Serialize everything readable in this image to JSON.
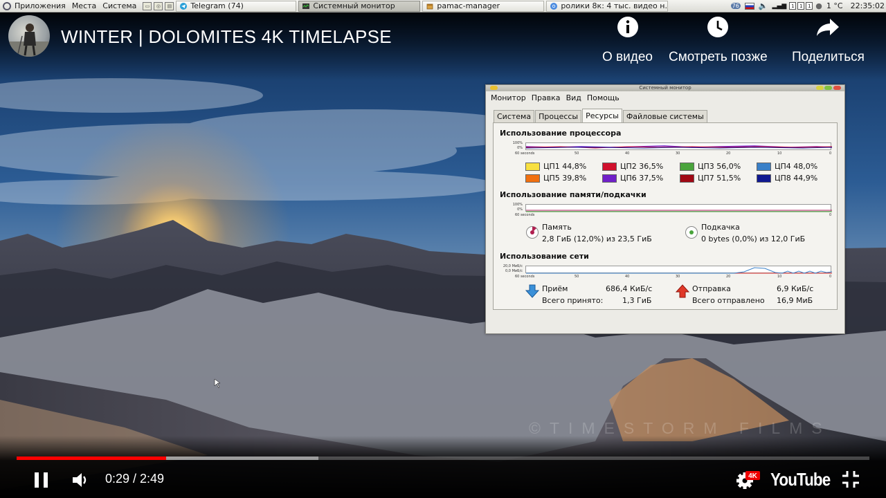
{
  "taskbar": {
    "menus": [
      "Приложения",
      "Места",
      "Система"
    ],
    "tasks": [
      {
        "label": "Telegram (74)",
        "active": false
      },
      {
        "label": "Системный монитор",
        "active": true
      },
      {
        "label": "pamac-manager",
        "active": false
      },
      {
        "label": "ролики 8к: 4 тыс. видео н...",
        "active": false
      }
    ],
    "tray": {
      "badge": "76",
      "kbd": [
        "1",
        "1",
        "1"
      ],
      "weather": "1 °C",
      "clock": "22:35:02"
    }
  },
  "video": {
    "title": "WINTER | DOLOMITES 4K TIMELAPSE",
    "actions": {
      "info": "О видео",
      "watch_later": "Смотреть позже",
      "share": "Поделиться"
    },
    "watermark": "©TIMESTORM FILMS",
    "time": "0:29 / 2:49",
    "quality_badge": "4K",
    "logo": "YouTube",
    "progress": {
      "played": 0.175,
      "buffered": 0.354
    }
  },
  "sysmon": {
    "title": "Системный монитор",
    "menu": [
      "Монитор",
      "Правка",
      "Вид",
      "Помощь"
    ],
    "tabs": [
      "Система",
      "Процессы",
      "Ресурсы",
      "Файловые системы"
    ],
    "active_tab": "Ресурсы",
    "axis_labels": {
      "x_left": "60 seconds",
      "ticks": [
        "50",
        "40",
        "30",
        "20",
        "10",
        "0"
      ]
    },
    "cpu": {
      "title": "Использование процессора",
      "y_top": "100%",
      "y_bottom": "0%",
      "cores": [
        {
          "label": "ЦП1 44,8%",
          "color": "#f8e040"
        },
        {
          "label": "ЦП2 36,5%",
          "color": "#d0102c"
        },
        {
          "label": "ЦП3 56,0%",
          "color": "#4aa43c"
        },
        {
          "label": "ЦП4 48,0%",
          "color": "#3a80c8"
        },
        {
          "label": "ЦП5 39,8%",
          "color": "#f07010"
        },
        {
          "label": "ЦП6 37,5%",
          "color": "#7020c8"
        },
        {
          "label": "ЦП7 51,5%",
          "color": "#a00814"
        },
        {
          "label": "ЦП8 44,9%",
          "color": "#101890"
        }
      ]
    },
    "memory": {
      "title": "Использование памяти/подкачки",
      "y_top": "100%",
      "y_bottom": "0%",
      "ram_label": "Память",
      "ram_value": "2,8 ГиБ (12,0%) из 23,5 ГиБ",
      "swap_label": "Подкачка",
      "swap_value": "0 bytes (0,0%) из 12,0 ГиБ"
    },
    "network": {
      "title": "Использование сети",
      "y_top": "20,0 МиБ/с",
      "y_bottom": "0,0 МиБ/с",
      "recv_label": "Приём",
      "recv_rate": "686,4 КиБ/с",
      "recv_total_label": "Всего принято:",
      "recv_total": "1,3 ГиБ",
      "send_label": "Отправка",
      "send_rate": "6,9 КиБ/с",
      "send_total_label": "Всего отправлено",
      "send_total": "16,9 МиБ"
    }
  }
}
